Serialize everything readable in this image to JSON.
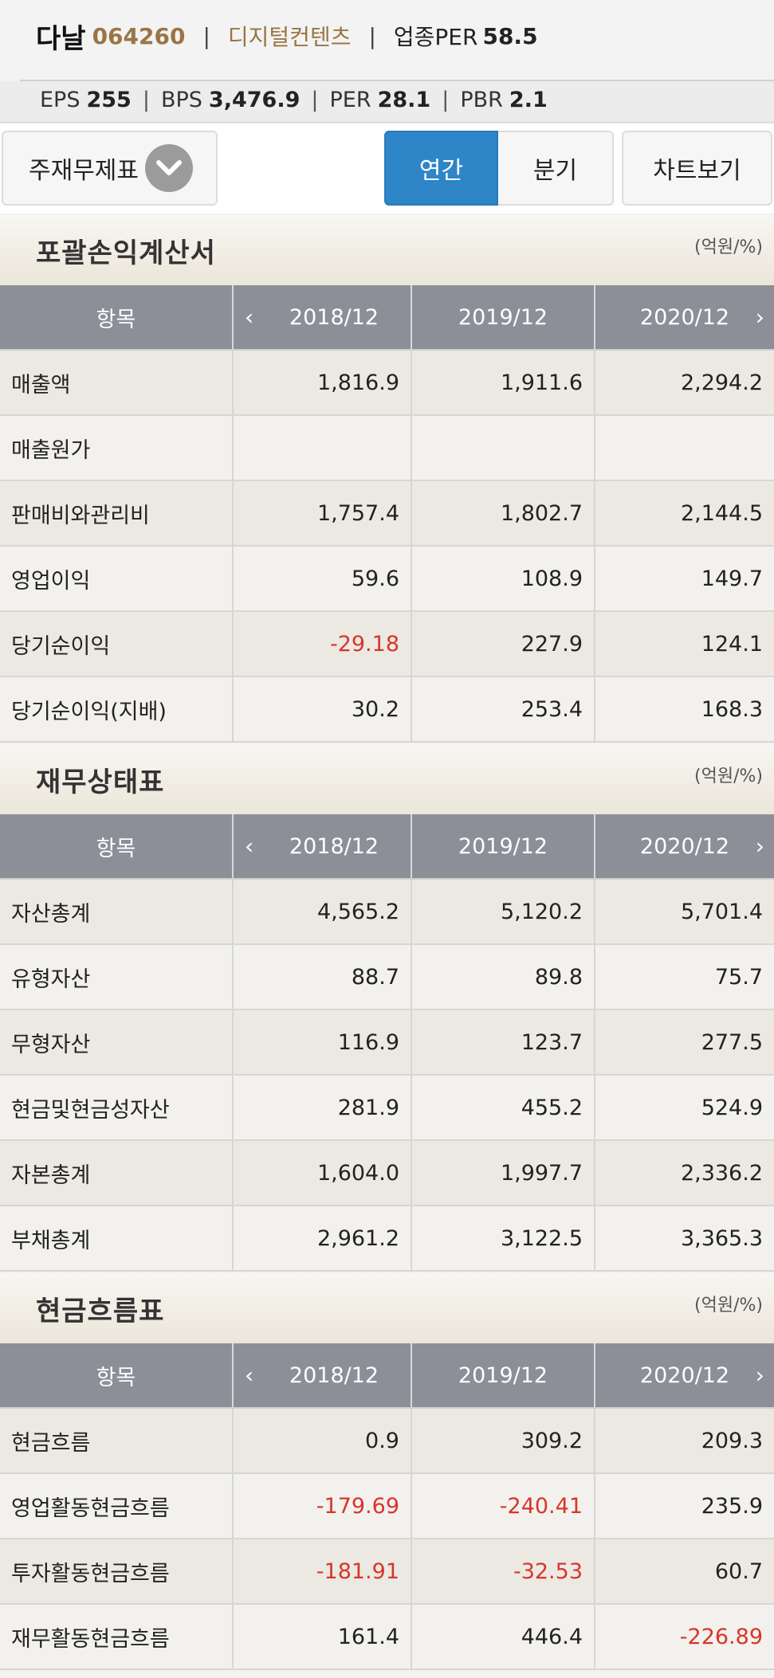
{
  "header": {
    "company": "다날",
    "code": "064260",
    "separator": "|",
    "industry": "디지털컨텐츠",
    "industry_per_label": "업종PER",
    "industry_per_value": "58.5"
  },
  "metrics": [
    {
      "label": "EPS",
      "value": "255"
    },
    {
      "label": "BPS",
      "value": "3,476.9"
    },
    {
      "label": "PER",
      "value": "28.1"
    },
    {
      "label": "PBR",
      "value": "2.1"
    }
  ],
  "metric_separator": "|",
  "controls": {
    "dropdown_label": "주재무제표",
    "annual_label": "연간",
    "quarter_label": "분기",
    "chart_label": "차트보기"
  },
  "columns": {
    "item": "항목",
    "periods": [
      "2018/12",
      "2019/12",
      "2020/12"
    ]
  },
  "arrows": {
    "left": "‹",
    "right": "›"
  },
  "sections": [
    {
      "title": "포괄손익계산서",
      "unit": "(억원/%)",
      "rows": [
        {
          "label": "매출액",
          "values": [
            "1,816.9",
            "1,911.6",
            "2,294.2"
          ]
        },
        {
          "label": "매출원가",
          "values": [
            "",
            "",
            ""
          ]
        },
        {
          "label": "판매비와관리비",
          "values": [
            "1,757.4",
            "1,802.7",
            "2,144.5"
          ]
        },
        {
          "label": "영업이익",
          "values": [
            "59.6",
            "108.9",
            "149.7"
          ]
        },
        {
          "label": "당기순이익",
          "values": [
            "-29.18",
            "227.9",
            "124.1"
          ]
        },
        {
          "label": "당기순이익(지배)",
          "values": [
            "30.2",
            "253.4",
            "168.3"
          ]
        }
      ]
    },
    {
      "title": "재무상태표",
      "unit": "(억원/%)",
      "rows": [
        {
          "label": "자산총계",
          "values": [
            "4,565.2",
            "5,120.2",
            "5,701.4"
          ]
        },
        {
          "label": "유형자산",
          "values": [
            "88.7",
            "89.8",
            "75.7"
          ]
        },
        {
          "label": "무형자산",
          "values": [
            "116.9",
            "123.7",
            "277.5"
          ]
        },
        {
          "label": "현금및현금성자산",
          "values": [
            "281.9",
            "455.2",
            "524.9"
          ]
        },
        {
          "label": "자본총계",
          "values": [
            "1,604.0",
            "1,997.7",
            "2,336.2"
          ]
        },
        {
          "label": "부채총계",
          "values": [
            "2,961.2",
            "3,122.5",
            "3,365.3"
          ]
        }
      ]
    },
    {
      "title": "현금흐름표",
      "unit": "(억원/%)",
      "rows": [
        {
          "label": "현금흐름",
          "values": [
            "0.9",
            "309.2",
            "209.3"
          ]
        },
        {
          "label": "영업활동현금흐름",
          "values": [
            "-179.69",
            "-240.41",
            "235.9"
          ]
        },
        {
          "label": "투자활동현금흐름",
          "values": [
            "-181.91",
            "-32.53",
            "60.7"
          ]
        },
        {
          "label": "재무활동현금흐름",
          "values": [
            "161.4",
            "446.4",
            "-226.89"
          ]
        }
      ]
    }
  ],
  "colors": {
    "accent": "#2e85c8",
    "negative": "#d8352a",
    "brand": "#9a7545",
    "table_header": "#8c8f97"
  }
}
